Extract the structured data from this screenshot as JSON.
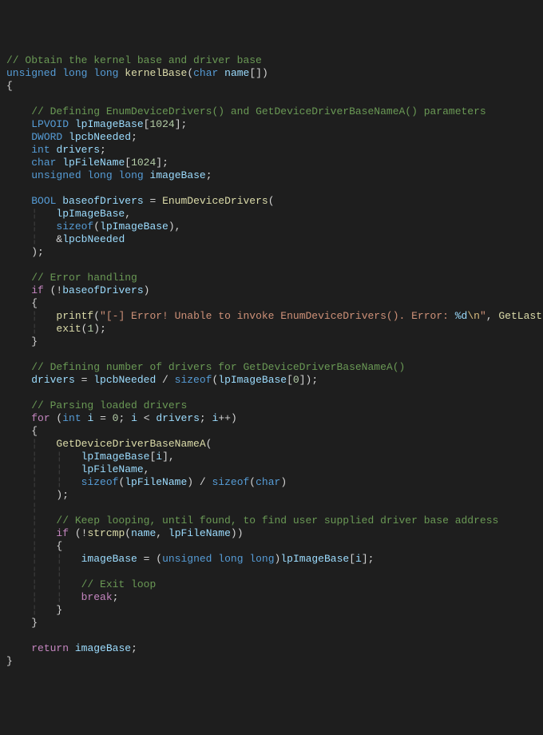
{
  "lines": {
    "l01_c": "// Obtain the kernel base and driver base",
    "l02_t1": "unsigned",
    "l02_t2": "long",
    "l02_t3": "long",
    "l02_f": "kernelBase",
    "l02_t4": "char",
    "l02_v": "name",
    "l05_c": "// Defining EnumDeviceDrivers() and GetDeviceDriverBaseNameA() parameters",
    "l06_t": "LPVOID",
    "l06_v": "lpImageBase",
    "l06_n": "1024",
    "l07_t": "DWORD",
    "l07_v": "lpcbNeeded",
    "l08_t": "int",
    "l08_v": "drivers",
    "l09_t": "char",
    "l09_v": "lpFileName",
    "l09_n": "1024",
    "l10_t1": "unsigned",
    "l10_t2": "long",
    "l10_t3": "long",
    "l10_v": "imageBase",
    "l12_t": "BOOL",
    "l12_v": "baseofDrivers",
    "l12_f": "EnumDeviceDrivers",
    "l13_v": "lpImageBase",
    "l14_f": "sizeof",
    "l14_v": "lpImageBase",
    "l15_v": "lpcbNeeded",
    "l18_c": "// Error handling",
    "l19_k": "if",
    "l19_v": "baseofDrivers",
    "l21_f": "printf",
    "l21_s1": "\"[-] Error! Unable to invoke EnumDeviceDrivers(). Error: ",
    "l21_e1": "%d",
    "l21_e2": "\\n",
    "l21_s2": "\"",
    "l21_f2": "GetLastError",
    "l22_f": "exit",
    "l22_n": "1",
    "l25_c": "// Defining number of drivers for GetDeviceDriverBaseNameA()",
    "l26_v1": "drivers",
    "l26_v2": "lpcbNeeded",
    "l26_f": "sizeof",
    "l26_v3": "lpImageBase",
    "l26_n": "0",
    "l28_c": "// Parsing loaded drivers",
    "l29_k": "for",
    "l29_t": "int",
    "l29_v1": "i",
    "l29_n": "0",
    "l29_v2": "i",
    "l29_v3": "drivers",
    "l29_v4": "i",
    "l31_f": "GetDeviceDriverBaseNameA",
    "l32_v": "lpImageBase",
    "l32_v2": "i",
    "l33_v": "lpFileName",
    "l34_f1": "sizeof",
    "l34_v1": "lpFileName",
    "l34_f2": "sizeof",
    "l34_t": "char",
    "l37_c": "// Keep looping, until found, to find user supplied driver base address",
    "l38_k": "if",
    "l38_f": "strcmp",
    "l38_v1": "name",
    "l38_v2": "lpFileName",
    "l40_v1": "imageBase",
    "l40_t1": "unsigned",
    "l40_t2": "long",
    "l40_t3": "long",
    "l40_v2": "lpImageBase",
    "l40_v3": "i",
    "l42_c": "// Exit loop",
    "l43_k": "break",
    "l47_k": "return",
    "l47_v": "imageBase"
  }
}
